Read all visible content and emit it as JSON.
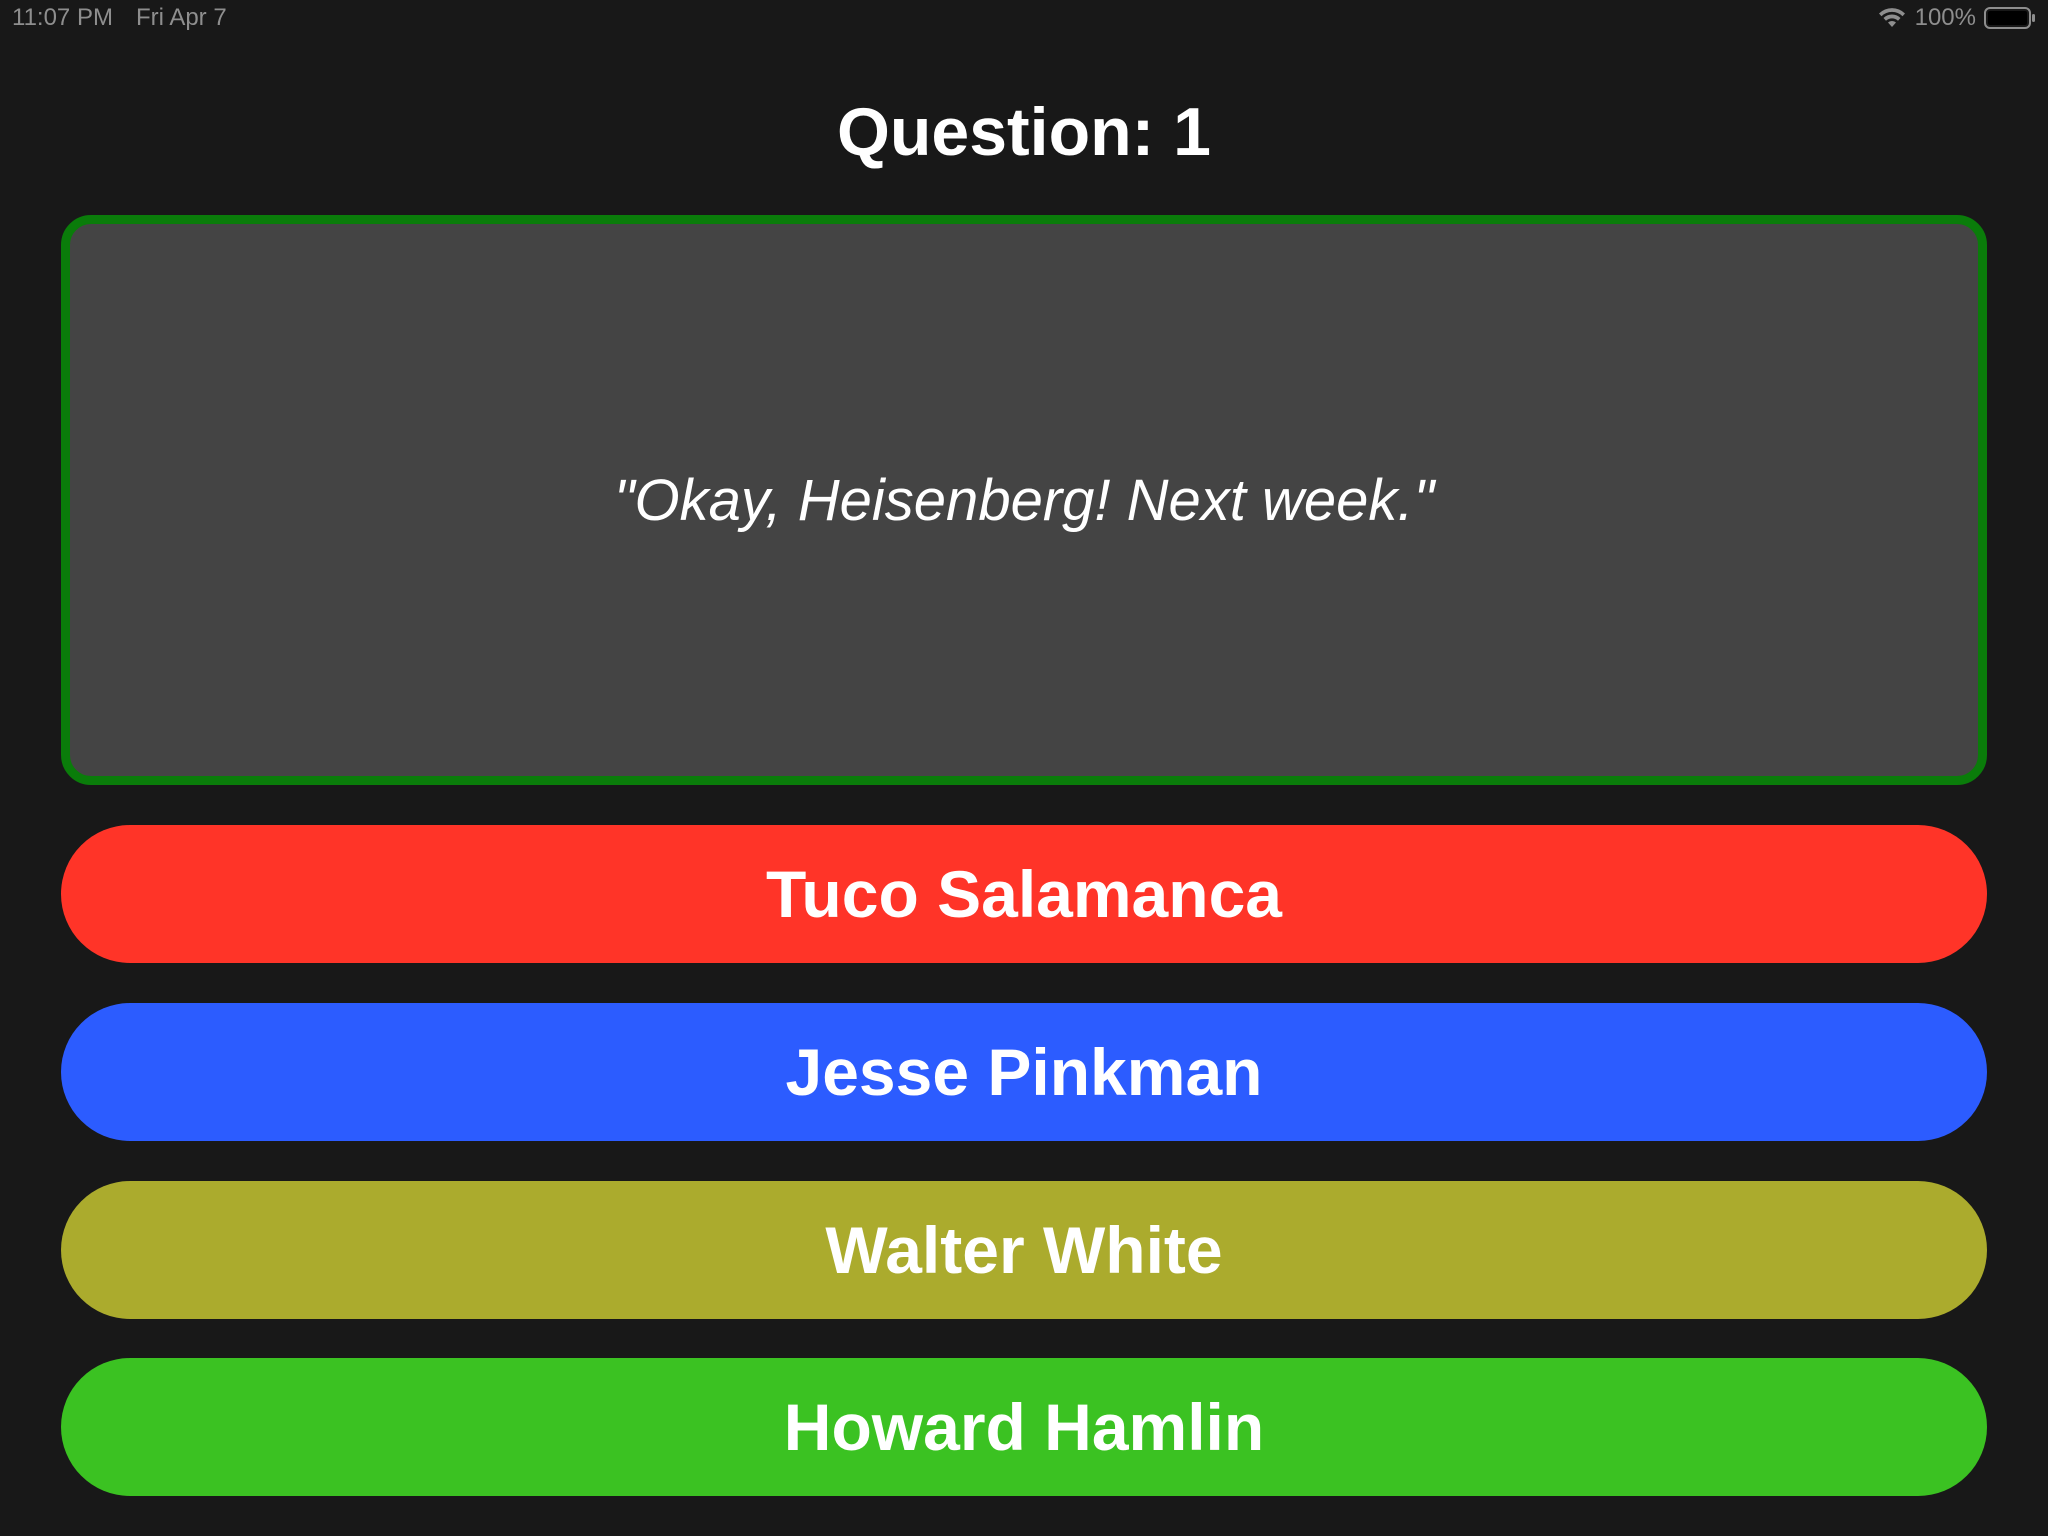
{
  "status_bar": {
    "time": "11:07 PM",
    "date": "Fri Apr 7",
    "battery": "100%",
    "wifi_icon": "wifi-icon",
    "battery_icon": "battery-icon"
  },
  "quiz": {
    "title": "Question: 1",
    "quote": "\"Okay, Heisenberg! Next week.\"",
    "quote_border_color": "#0a7c0a",
    "answers": [
      {
        "label": "Tuco Salamanca",
        "color": "#ff3428"
      },
      {
        "label": "Jesse Pinkman",
        "color": "#2c5cff"
      },
      {
        "label": "Walter White",
        "color": "#abab2d"
      },
      {
        "label": "Howard Hamlin",
        "color": "#3bc222"
      }
    ]
  }
}
